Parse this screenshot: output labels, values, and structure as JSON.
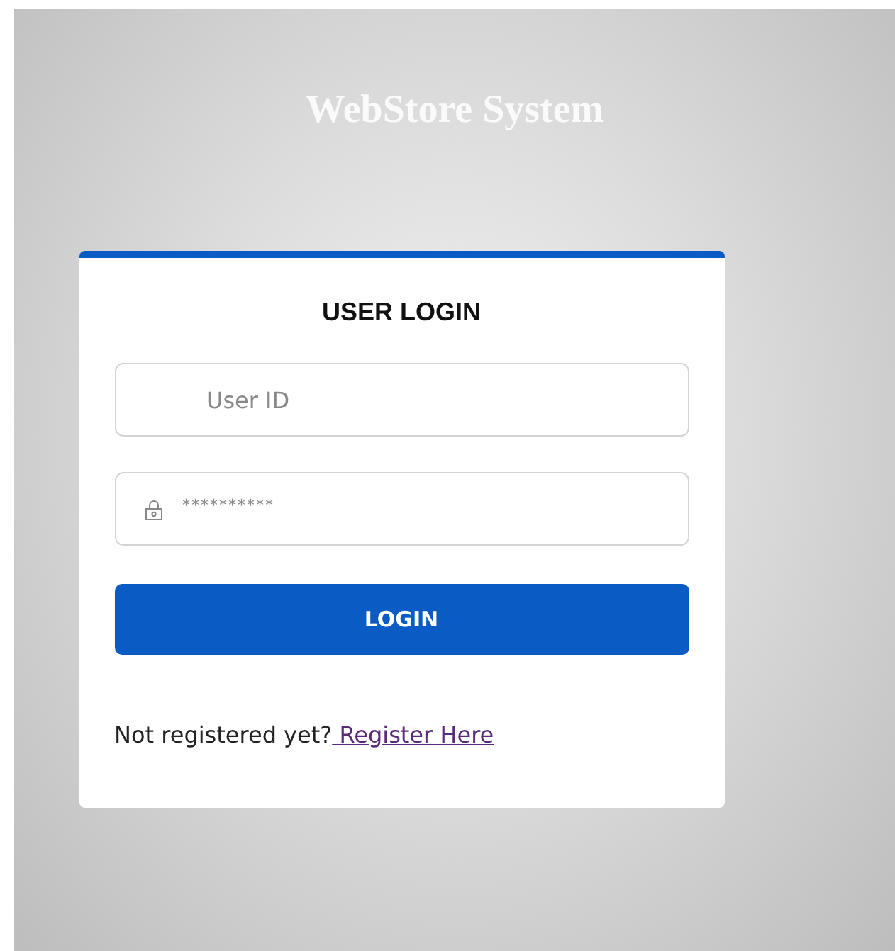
{
  "page": {
    "title": "WebStore System"
  },
  "login": {
    "heading": "USER LOGIN",
    "user_field": {
      "placeholder": "User ID"
    },
    "password_field": {
      "value": "**********"
    },
    "button": "LOGIN",
    "prompt": "Not registered yet?",
    "link": " Register Here"
  }
}
